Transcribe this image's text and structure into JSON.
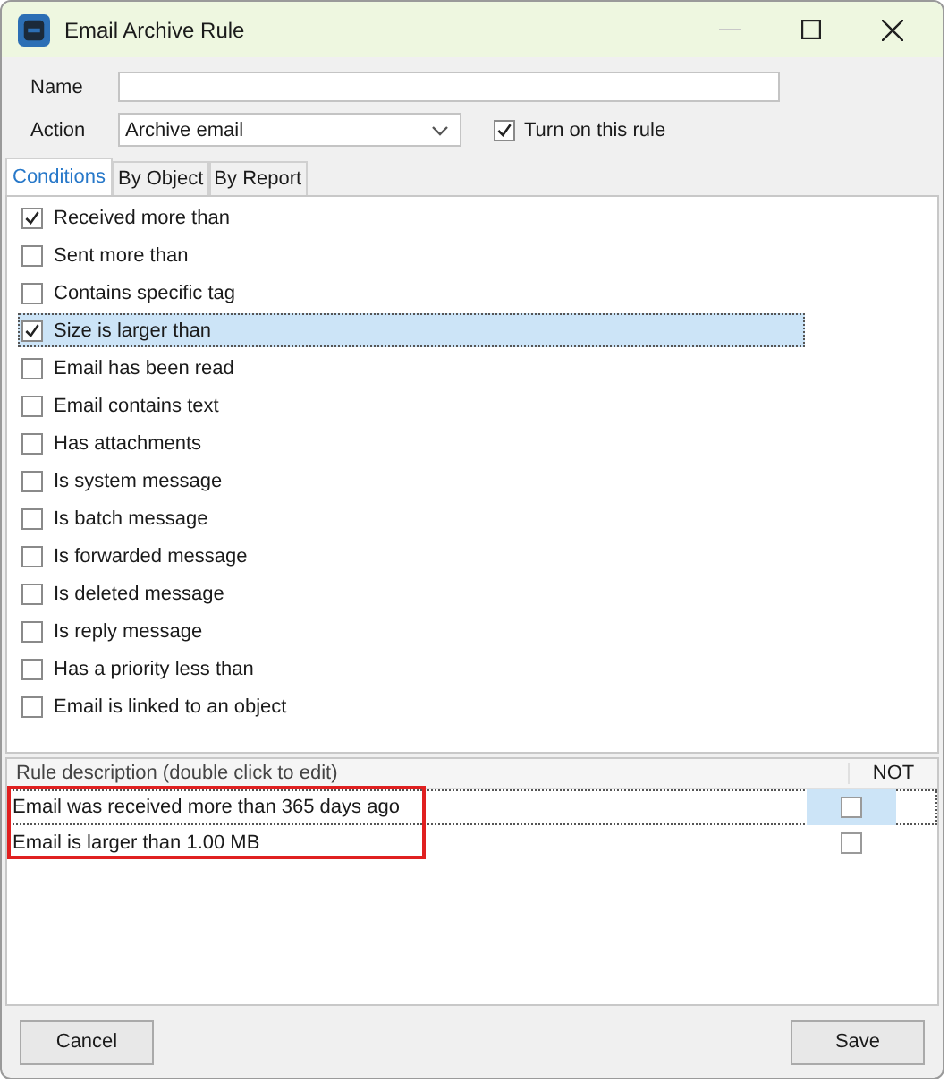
{
  "window": {
    "title": "Email Archive Rule"
  },
  "form": {
    "name_label": "Name",
    "action_label": "Action",
    "action_value": "Archive email",
    "turn_on": {
      "label": "Turn on this rule",
      "checked": true
    }
  },
  "tabs": [
    {
      "label": "Conditions",
      "selected": true
    },
    {
      "label": "By Object",
      "selected": false
    },
    {
      "label": "By Report",
      "selected": false
    }
  ],
  "conditions": [
    {
      "label": "Received more than",
      "checked": true,
      "selected": false
    },
    {
      "label": "Sent more than",
      "checked": false,
      "selected": false
    },
    {
      "label": "Contains specific tag",
      "checked": false,
      "selected": false
    },
    {
      "label": "Size is larger than",
      "checked": true,
      "selected": true
    },
    {
      "label": "Email has been read",
      "checked": false,
      "selected": false
    },
    {
      "label": "Email contains text",
      "checked": false,
      "selected": false
    },
    {
      "label": "Has attachments",
      "checked": false,
      "selected": false
    },
    {
      "label": "Is system message",
      "checked": false,
      "selected": false
    },
    {
      "label": "Is batch message",
      "checked": false,
      "selected": false
    },
    {
      "label": "Is forwarded message",
      "checked": false,
      "selected": false
    },
    {
      "label": "Is deleted message",
      "checked": false,
      "selected": false
    },
    {
      "label": "Is reply message",
      "checked": false,
      "selected": false
    },
    {
      "label": "Has a priority less than",
      "checked": false,
      "selected": false
    },
    {
      "label": "Email is linked to an object",
      "checked": false,
      "selected": false
    }
  ],
  "rules": {
    "columns": [
      "Rule description (double click to edit)",
      "NOT"
    ],
    "rows": [
      {
        "description": "Email was received more than 365 days ago",
        "not": false,
        "selected": true
      },
      {
        "description": "Email is larger than 1.00 MB",
        "not": false,
        "selected": false
      }
    ]
  },
  "buttons": [
    {
      "label": "Cancel",
      "kind": "cancel"
    },
    {
      "label": "Save",
      "kind": "save"
    }
  ]
}
